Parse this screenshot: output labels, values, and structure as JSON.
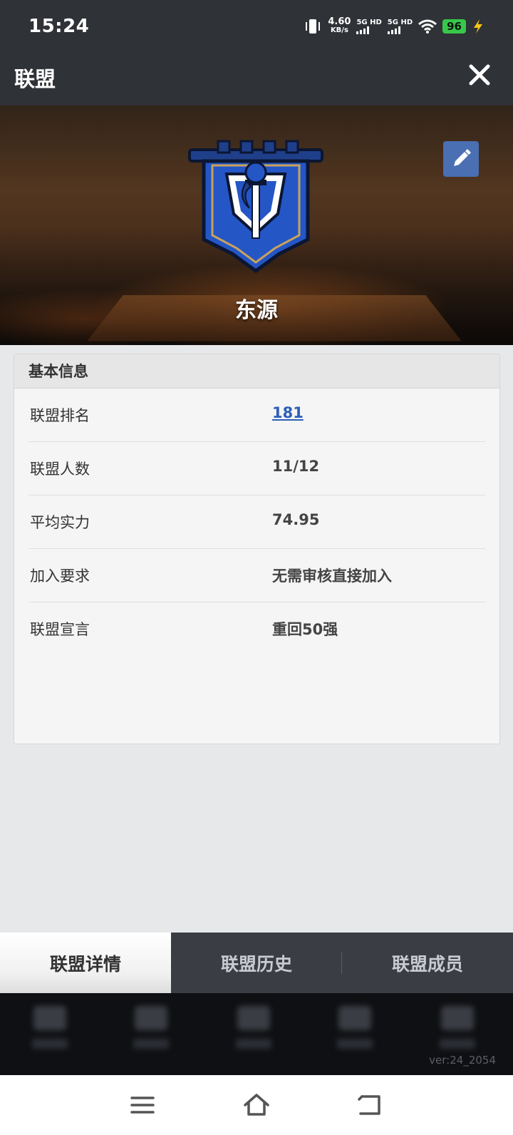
{
  "status_bar": {
    "time": "15:24",
    "net_speed_value": "4.60",
    "net_speed_unit": "KB/s",
    "sim1": "5G HD",
    "sim2": "5G HD",
    "battery": "96"
  },
  "header": {
    "title": "联盟"
  },
  "banner": {
    "union_name": "东源"
  },
  "info": {
    "section_title": "基本信息",
    "rows": [
      {
        "label": "联盟排名",
        "value": "181"
      },
      {
        "label": "联盟人数",
        "value": "11/12"
      },
      {
        "label": "平均实力",
        "value": "74.95"
      },
      {
        "label": "加入要求",
        "value": "无需审核直接加入"
      },
      {
        "label": "联盟宣言",
        "value": "重回50强"
      }
    ]
  },
  "tabs": [
    {
      "label": "联盟详情",
      "active": true
    },
    {
      "label": "联盟历史",
      "active": false
    },
    {
      "label": "联盟成员",
      "active": false
    }
  ],
  "footer": {
    "version": "ver:24_2054"
  },
  "colors": {
    "header_bg": "#2f3237",
    "link_blue": "#2b5fb8",
    "edit_button": "#4a6fb3",
    "battery_green": "#36c84a"
  }
}
